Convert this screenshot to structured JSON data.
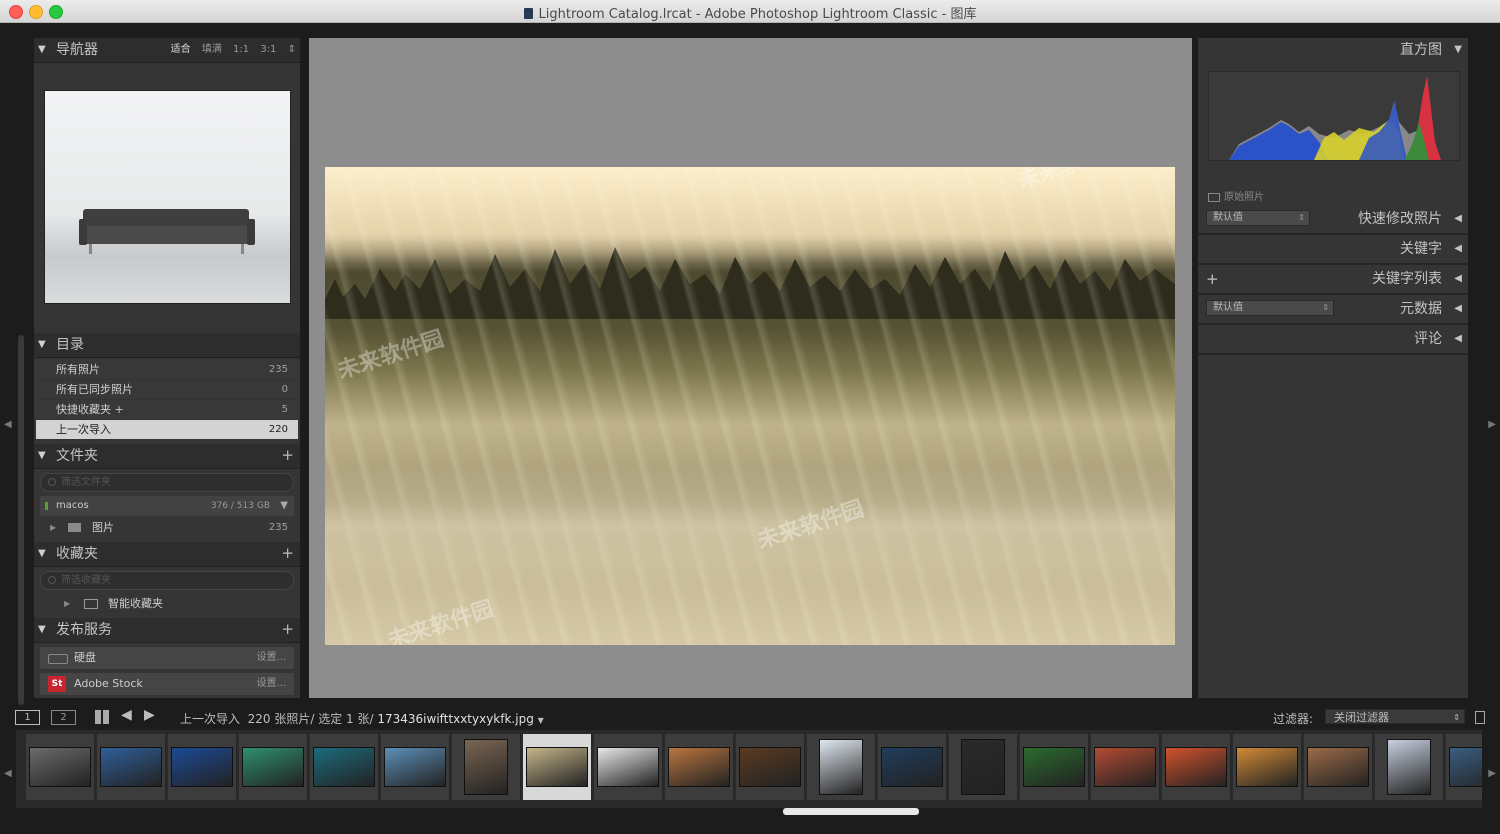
{
  "window": {
    "title": "Lightroom Catalog.lrcat - Adobe Photoshop Lightroom Classic - 图库"
  },
  "navigator": {
    "title": "导航器",
    "zoom_options": [
      "适合",
      "填满",
      "1:1",
      "3:1"
    ],
    "zoom_active": "适合"
  },
  "catalog": {
    "title": "目录",
    "items": [
      {
        "label": "所有照片",
        "count": "235"
      },
      {
        "label": "所有已同步照片",
        "count": "0"
      },
      {
        "label": "快捷收藏夹 +",
        "count": "5"
      },
      {
        "label": "上一次导入",
        "count": "220"
      }
    ]
  },
  "folders": {
    "title": "文件夹",
    "plus": "+",
    "search_placeholder": "筛选文件夹",
    "volume": {
      "name": "macos",
      "size": "376 / 513 GB"
    },
    "items": [
      {
        "label": "图片",
        "count": "235"
      }
    ]
  },
  "collections": {
    "title": "收藏夹",
    "plus": "+",
    "search_placeholder": "筛选收藏夹",
    "items": [
      {
        "label": "智能收藏夹"
      }
    ]
  },
  "publish": {
    "title": "发布服务",
    "plus": "+",
    "items": [
      {
        "label": "硬盘",
        "action": "设置..."
      },
      {
        "label": "Adobe Stock",
        "action": "设置..."
      }
    ]
  },
  "histogram": {
    "title": "直方图",
    "original_label": "原始照片",
    "colors": [
      "#2c52c8",
      "#3d8a3b",
      "#d7d02c",
      "#d8313f"
    ]
  },
  "right_panels": [
    {
      "label": "快速修改照片",
      "preset": "默认值"
    },
    {
      "label": "关键字"
    },
    {
      "label": "关键字列表",
      "plus": "+"
    },
    {
      "label": "元数据",
      "preset": "默认值"
    },
    {
      "label": "评论"
    }
  ],
  "toolbar": {
    "screen1": "1",
    "screen2": "2",
    "source": "上一次导入",
    "info": "220 张照片/ 选定 1 张/",
    "filename": "173436iwifttxxtyxykfk.jpg",
    "filter_label": "过滤器:",
    "filter_value": "关闭过滤器"
  },
  "watermark": {
    "name": "未来软件园",
    "url": "www.orsoon.com"
  },
  "filmstrip": {
    "selected_index": 7,
    "thumbs": [
      "#6b6b6b",
      "#2f5f99",
      "#1c4a96",
      "#2f8f6e",
      "#1c6b7c",
      "#5c8fb8",
      "#7a6552",
      "#c6b58a",
      "#e8e8e8",
      "#b9753f",
      "#5a3b22",
      "#dfe7f0",
      "#1f3d5c",
      "#2a2a2a",
      "#2b6b2e",
      "#b34b32",
      "#d1522c",
      "#d18a37",
      "#9c6b47",
      "#c7d0e0",
      "#3a5d80"
    ]
  }
}
